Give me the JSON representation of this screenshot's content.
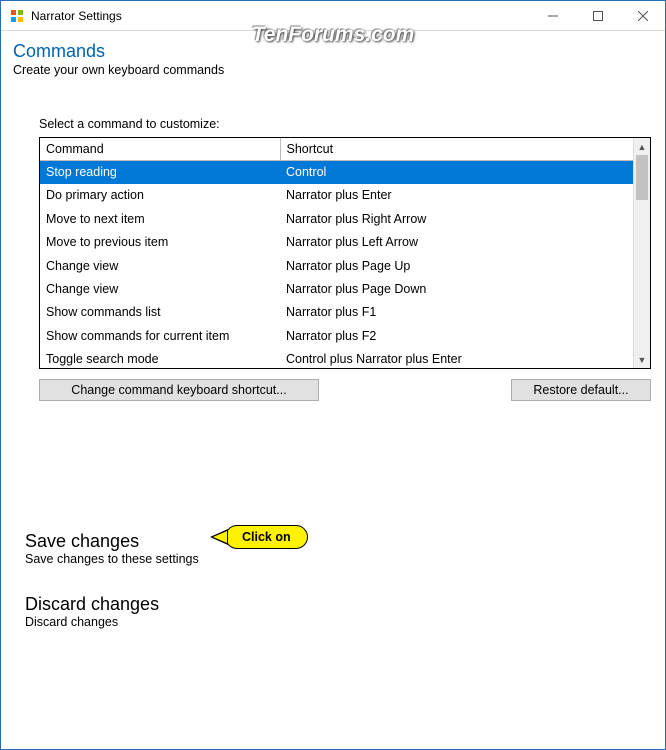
{
  "titlebar": {
    "title": "Narrator Settings"
  },
  "watermark": "TenForums.com",
  "page": {
    "heading": "Commands",
    "subtitle": "Create your own keyboard commands"
  },
  "table": {
    "label": "Select a command to customize:",
    "headers": {
      "command": "Command",
      "shortcut": "Shortcut"
    },
    "rows": [
      {
        "command": "Stop reading",
        "shortcut": "Control",
        "selected": true
      },
      {
        "command": "Do primary action",
        "shortcut": "Narrator plus Enter",
        "selected": false
      },
      {
        "command": "Move to next item",
        "shortcut": "Narrator plus Right Arrow",
        "selected": false
      },
      {
        "command": "Move to previous item",
        "shortcut": "Narrator plus Left Arrow",
        "selected": false
      },
      {
        "command": "Change view",
        "shortcut": "Narrator plus Page Up",
        "selected": false
      },
      {
        "command": "Change view",
        "shortcut": "Narrator plus Page Down",
        "selected": false
      },
      {
        "command": "Show commands list",
        "shortcut": "Narrator plus F1",
        "selected": false
      },
      {
        "command": "Show commands for current item",
        "shortcut": "Narrator plus F2",
        "selected": false
      },
      {
        "command": "Toggle search mode",
        "shortcut": "Control plus Narrator plus Enter",
        "selected": false
      }
    ]
  },
  "buttons": {
    "change": "Change command keyboard shortcut...",
    "restore": "Restore default..."
  },
  "actions": {
    "save": {
      "title": "Save changes",
      "sub": "Save changes to these settings"
    },
    "discard": {
      "title": "Discard changes",
      "sub": "Discard changes"
    }
  },
  "callout": {
    "text": "Click on"
  }
}
